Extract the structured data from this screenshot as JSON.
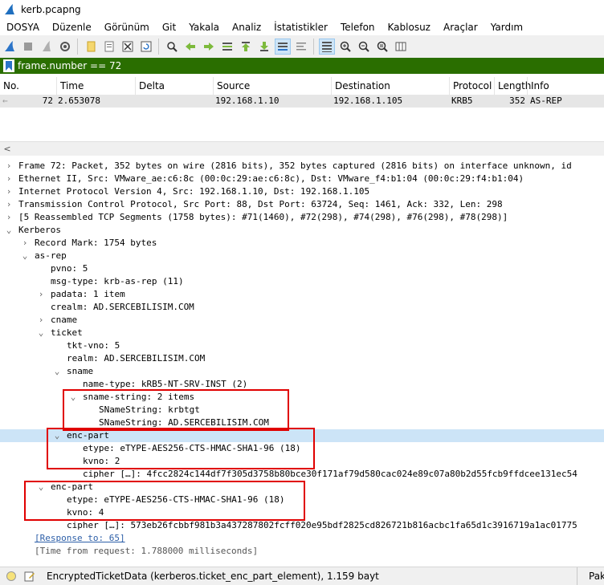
{
  "window": {
    "title": "kerb.pcapng"
  },
  "menu": [
    "DOSYA",
    "Düzenle",
    "Görünüm",
    "Git",
    "Yakala",
    "Analiz",
    "İstatistikler",
    "Telefon",
    "Kablosuz",
    "Araçlar",
    "Yardım"
  ],
  "filter": {
    "value": "frame.number == 72"
  },
  "columns": {
    "no": "No.",
    "time": "Time",
    "delta": "Delta",
    "source": "Source",
    "destination": "Destination",
    "protocol": "Protocol",
    "length": "Length",
    "info": "Info"
  },
  "packet": {
    "no": "72",
    "time": "2.653078",
    "delta": "",
    "source": "192.168.1.10",
    "destination": "192.168.1.105",
    "protocol": "KRB5",
    "length": "352",
    "info": "AS-REP"
  },
  "details": [
    "Frame 72: Packet, 352 bytes on wire (2816 bits), 352 bytes captured (2816 bits) on interface unknown, id",
    "Ethernet II, Src: VMware_ae:c6:8c (00:0c:29:ae:c6:8c), Dst: VMware_f4:b1:04 (00:0c:29:f4:b1:04)",
    "Internet Protocol Version 4, Src: 192.168.1.10, Dst: 192.168.1.105",
    "Transmission Control Protocol, Src Port: 88, Dst Port: 63724, Seq: 1461, Ack: 332, Len: 298",
    "[5 Reassembled TCP Segments (1758 bytes): #71(1460), #72(298), #74(298), #76(298), #78(298)]",
    "Kerberos",
    "Record Mark: 1754 bytes",
    "as-rep",
    "pvno: 5",
    "msg-type: krb-as-rep (11)",
    "padata: 1 item",
    "crealm: AD.SERCEBILISIM.COM",
    "cname",
    "ticket",
    "tkt-vno: 5",
    "realm: AD.SERCEBILISIM.COM",
    "sname",
    "name-type: kRB5-NT-SRV-INST (2)",
    "sname-string: 2 items",
    "SNameString: krbtgt",
    "SNameString: AD.SERCEBILISIM.COM",
    "enc-part",
    "etype: eTYPE-AES256-CTS-HMAC-SHA1-96 (18)",
    "kvno: 2",
    "cipher […]: 4fcc2824c144df7f305d3758b80bce30f171af79d580cac024e89c07a80b2d55fcb9ffdcee131ec54",
    "enc-part",
    "etype: eTYPE-AES256-CTS-HMAC-SHA1-96 (18)",
    "kvno: 4",
    "cipher […]: 573eb26fcbbf981b3a437287802fcff020e95bdf2825cd826721b816acbc1fa65d1c3916719a1ac01775",
    "[Response to: 65]",
    "[Time from request: 1.788000 milliseconds]"
  ],
  "status": {
    "text": "EncryptedTicketData (kerberos.ticket_enc_part_element), 1.159 bayt",
    "right": "Pak"
  }
}
